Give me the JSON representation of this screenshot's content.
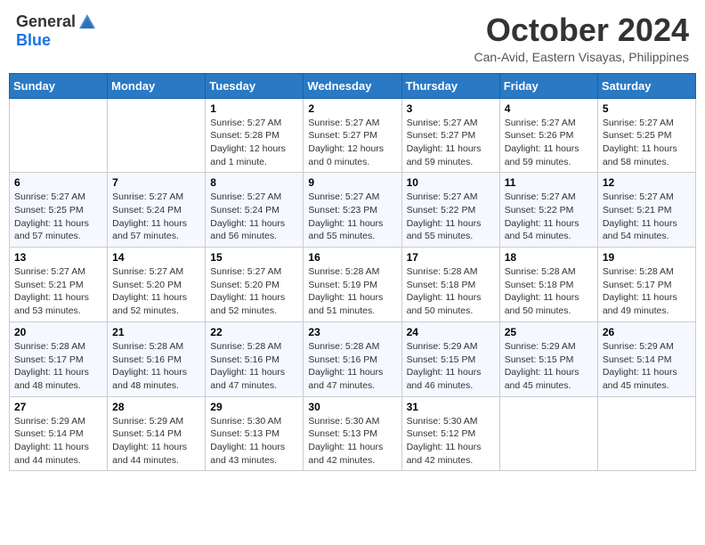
{
  "logo": {
    "text_general": "General",
    "text_blue": "Blue"
  },
  "header": {
    "month": "October 2024",
    "location": "Can-Avid, Eastern Visayas, Philippines"
  },
  "weekdays": [
    "Sunday",
    "Monday",
    "Tuesday",
    "Wednesday",
    "Thursday",
    "Friday",
    "Saturday"
  ],
  "weeks": [
    [
      null,
      null,
      {
        "day": "1",
        "sunrise": "Sunrise: 5:27 AM",
        "sunset": "Sunset: 5:28 PM",
        "daylight": "Daylight: 12 hours and 1 minute."
      },
      {
        "day": "2",
        "sunrise": "Sunrise: 5:27 AM",
        "sunset": "Sunset: 5:27 PM",
        "daylight": "Daylight: 12 hours and 0 minutes."
      },
      {
        "day": "3",
        "sunrise": "Sunrise: 5:27 AM",
        "sunset": "Sunset: 5:27 PM",
        "daylight": "Daylight: 11 hours and 59 minutes."
      },
      {
        "day": "4",
        "sunrise": "Sunrise: 5:27 AM",
        "sunset": "Sunset: 5:26 PM",
        "daylight": "Daylight: 11 hours and 59 minutes."
      },
      {
        "day": "5",
        "sunrise": "Sunrise: 5:27 AM",
        "sunset": "Sunset: 5:25 PM",
        "daylight": "Daylight: 11 hours and 58 minutes."
      }
    ],
    [
      {
        "day": "6",
        "sunrise": "Sunrise: 5:27 AM",
        "sunset": "Sunset: 5:25 PM",
        "daylight": "Daylight: 11 hours and 57 minutes."
      },
      {
        "day": "7",
        "sunrise": "Sunrise: 5:27 AM",
        "sunset": "Sunset: 5:24 PM",
        "daylight": "Daylight: 11 hours and 57 minutes."
      },
      {
        "day": "8",
        "sunrise": "Sunrise: 5:27 AM",
        "sunset": "Sunset: 5:24 PM",
        "daylight": "Daylight: 11 hours and 56 minutes."
      },
      {
        "day": "9",
        "sunrise": "Sunrise: 5:27 AM",
        "sunset": "Sunset: 5:23 PM",
        "daylight": "Daylight: 11 hours and 55 minutes."
      },
      {
        "day": "10",
        "sunrise": "Sunrise: 5:27 AM",
        "sunset": "Sunset: 5:22 PM",
        "daylight": "Daylight: 11 hours and 55 minutes."
      },
      {
        "day": "11",
        "sunrise": "Sunrise: 5:27 AM",
        "sunset": "Sunset: 5:22 PM",
        "daylight": "Daylight: 11 hours and 54 minutes."
      },
      {
        "day": "12",
        "sunrise": "Sunrise: 5:27 AM",
        "sunset": "Sunset: 5:21 PM",
        "daylight": "Daylight: 11 hours and 54 minutes."
      }
    ],
    [
      {
        "day": "13",
        "sunrise": "Sunrise: 5:27 AM",
        "sunset": "Sunset: 5:21 PM",
        "daylight": "Daylight: 11 hours and 53 minutes."
      },
      {
        "day": "14",
        "sunrise": "Sunrise: 5:27 AM",
        "sunset": "Sunset: 5:20 PM",
        "daylight": "Daylight: 11 hours and 52 minutes."
      },
      {
        "day": "15",
        "sunrise": "Sunrise: 5:27 AM",
        "sunset": "Sunset: 5:20 PM",
        "daylight": "Daylight: 11 hours and 52 minutes."
      },
      {
        "day": "16",
        "sunrise": "Sunrise: 5:28 AM",
        "sunset": "Sunset: 5:19 PM",
        "daylight": "Daylight: 11 hours and 51 minutes."
      },
      {
        "day": "17",
        "sunrise": "Sunrise: 5:28 AM",
        "sunset": "Sunset: 5:18 PM",
        "daylight": "Daylight: 11 hours and 50 minutes."
      },
      {
        "day": "18",
        "sunrise": "Sunrise: 5:28 AM",
        "sunset": "Sunset: 5:18 PM",
        "daylight": "Daylight: 11 hours and 50 minutes."
      },
      {
        "day": "19",
        "sunrise": "Sunrise: 5:28 AM",
        "sunset": "Sunset: 5:17 PM",
        "daylight": "Daylight: 11 hours and 49 minutes."
      }
    ],
    [
      {
        "day": "20",
        "sunrise": "Sunrise: 5:28 AM",
        "sunset": "Sunset: 5:17 PM",
        "daylight": "Daylight: 11 hours and 48 minutes."
      },
      {
        "day": "21",
        "sunrise": "Sunrise: 5:28 AM",
        "sunset": "Sunset: 5:16 PM",
        "daylight": "Daylight: 11 hours and 48 minutes."
      },
      {
        "day": "22",
        "sunrise": "Sunrise: 5:28 AM",
        "sunset": "Sunset: 5:16 PM",
        "daylight": "Daylight: 11 hours and 47 minutes."
      },
      {
        "day": "23",
        "sunrise": "Sunrise: 5:28 AM",
        "sunset": "Sunset: 5:16 PM",
        "daylight": "Daylight: 11 hours and 47 minutes."
      },
      {
        "day": "24",
        "sunrise": "Sunrise: 5:29 AM",
        "sunset": "Sunset: 5:15 PM",
        "daylight": "Daylight: 11 hours and 46 minutes."
      },
      {
        "day": "25",
        "sunrise": "Sunrise: 5:29 AM",
        "sunset": "Sunset: 5:15 PM",
        "daylight": "Daylight: 11 hours and 45 minutes."
      },
      {
        "day": "26",
        "sunrise": "Sunrise: 5:29 AM",
        "sunset": "Sunset: 5:14 PM",
        "daylight": "Daylight: 11 hours and 45 minutes."
      }
    ],
    [
      {
        "day": "27",
        "sunrise": "Sunrise: 5:29 AM",
        "sunset": "Sunset: 5:14 PM",
        "daylight": "Daylight: 11 hours and 44 minutes."
      },
      {
        "day": "28",
        "sunrise": "Sunrise: 5:29 AM",
        "sunset": "Sunset: 5:14 PM",
        "daylight": "Daylight: 11 hours and 44 minutes."
      },
      {
        "day": "29",
        "sunrise": "Sunrise: 5:30 AM",
        "sunset": "Sunset: 5:13 PM",
        "daylight": "Daylight: 11 hours and 43 minutes."
      },
      {
        "day": "30",
        "sunrise": "Sunrise: 5:30 AM",
        "sunset": "Sunset: 5:13 PM",
        "daylight": "Daylight: 11 hours and 42 minutes."
      },
      {
        "day": "31",
        "sunrise": "Sunrise: 5:30 AM",
        "sunset": "Sunset: 5:12 PM",
        "daylight": "Daylight: 11 hours and 42 minutes."
      },
      null,
      null
    ]
  ]
}
